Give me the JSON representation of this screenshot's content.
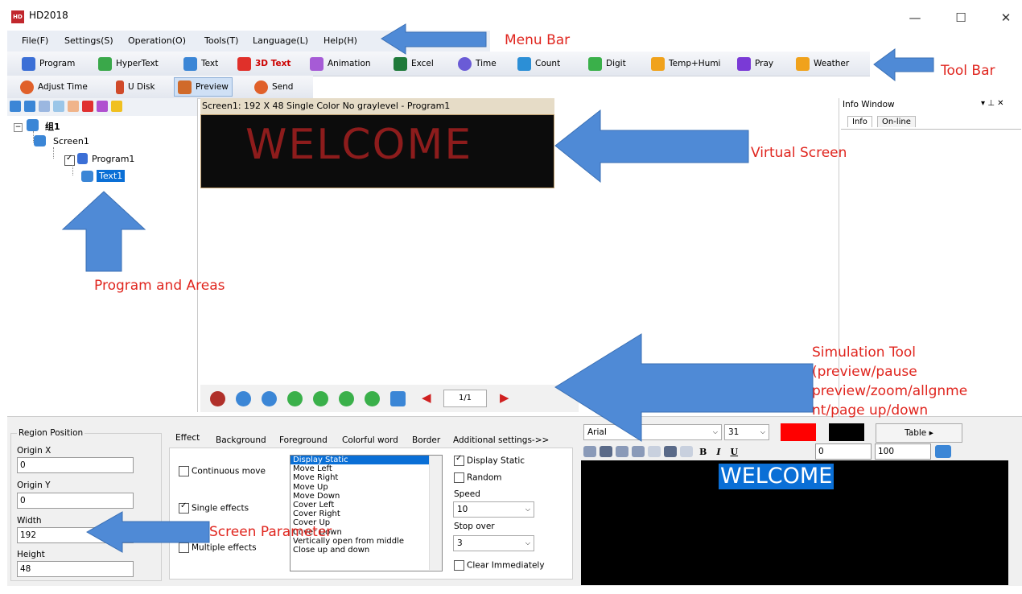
{
  "window": {
    "logo_text": "HD",
    "title": "HD2018",
    "minimize": "—",
    "maximize": "☐",
    "close": "✕"
  },
  "menu": [
    "File(F)",
    "Settings(S)",
    "Operation(O)",
    "Tools(T)",
    "Language(L)",
    "Help(H)"
  ],
  "toolbar1": [
    {
      "label": "Program",
      "icon": "program-icon",
      "color": "#3b6fd6"
    },
    {
      "label": "HyperText",
      "icon": "hypertext-icon",
      "color": "#3aa84a"
    },
    {
      "label": "Text",
      "icon": "text-icon",
      "color": "#3b86d6"
    },
    {
      "label": "3D Text",
      "icon": "3d-text-icon",
      "color": "#e0302a"
    },
    {
      "label": "Animation",
      "icon": "animation-icon",
      "color": "#a65bd6"
    },
    {
      "label": "Excel",
      "icon": "excel-icon",
      "color": "#1f7a3a"
    },
    {
      "label": "Time",
      "icon": "time-icon",
      "color": "#6a5bd6"
    },
    {
      "label": "Count",
      "icon": "count-icon",
      "color": "#2c8fd6"
    },
    {
      "label": "Digit",
      "icon": "digit-icon",
      "color": "#3ab04a"
    },
    {
      "label": "Temp+Humi",
      "icon": "temp-humi-icon",
      "color": "#f0a21c"
    },
    {
      "label": "Pray",
      "icon": "pray-icon",
      "color": "#7a3ad6"
    },
    {
      "label": "Weather",
      "icon": "weather-icon",
      "color": "#f0a21c"
    }
  ],
  "toolbar2": [
    {
      "label": "Adjust Time",
      "icon": "adjust-time-icon",
      "color": "#e0602a"
    },
    {
      "label": "U Disk",
      "icon": "u-disk-icon",
      "color": "#d04a2a"
    },
    {
      "label": "Preview",
      "icon": "preview-icon",
      "color": "#d06a2a"
    },
    {
      "label": "Send",
      "icon": "send-icon",
      "color": "#e0602a"
    }
  ],
  "tree": {
    "group": "组1",
    "screen": "Screen1",
    "program": "Program1",
    "text": "Text1"
  },
  "virtual_screen": {
    "header": "Screen1: 192 X 48  Single Color No graylevel - Program1",
    "text": "WELCOME"
  },
  "sim_toolbar": {
    "page": "1/1"
  },
  "info_window": {
    "title": "Info Window",
    "tabs": [
      "Info",
      "On-line"
    ]
  },
  "region": {
    "title": "Region Position",
    "origin_x_label": "Origin X",
    "origin_x": "0",
    "origin_y_label": "Origin Y",
    "origin_y": "0",
    "width_label": "Width",
    "width": "192",
    "height_label": "Height",
    "height": "48"
  },
  "effect_tabs": [
    "Effect",
    "Background",
    "Foreground",
    "Colorful word",
    "Border",
    "Additional settings->>"
  ],
  "effect": {
    "continuous_move": "Continuous move",
    "single_effects": "Single effects",
    "multiple_effects": "Multiple effects",
    "list": [
      "Display Static",
      "Move Left",
      "Move Right",
      "Move Up",
      "Move Down",
      "Cover Left",
      "Cover Right",
      "Cover Up",
      "Cover Down",
      "Vertically open from middle",
      "Close up and down"
    ],
    "display_static": "Display Static",
    "random": "Random",
    "speed_label": "Speed",
    "speed": "10",
    "stop_over_label": "Stop over",
    "stop_over": "3",
    "clear_immediately": "Clear Immediately"
  },
  "editor": {
    "font": "Arial",
    "size": "31",
    "table_btn": "Table",
    "spacing": "0",
    "scale": "100",
    "text": "WELCOME",
    "text_color": "#ff0000",
    "bg_color": "#000000"
  },
  "annotations": {
    "menu_bar": "Menu Bar",
    "tool_bar": "Tool Bar",
    "virtual_screen": "Virtual Screen",
    "program_areas": "Program and Areas",
    "simulation_tool": [
      "Simulation Tool",
      "(preview/pause",
      "preview/zoom/allgnme",
      "nt/page up/down"
    ],
    "screen_parameter": "Screen Parameter"
  }
}
